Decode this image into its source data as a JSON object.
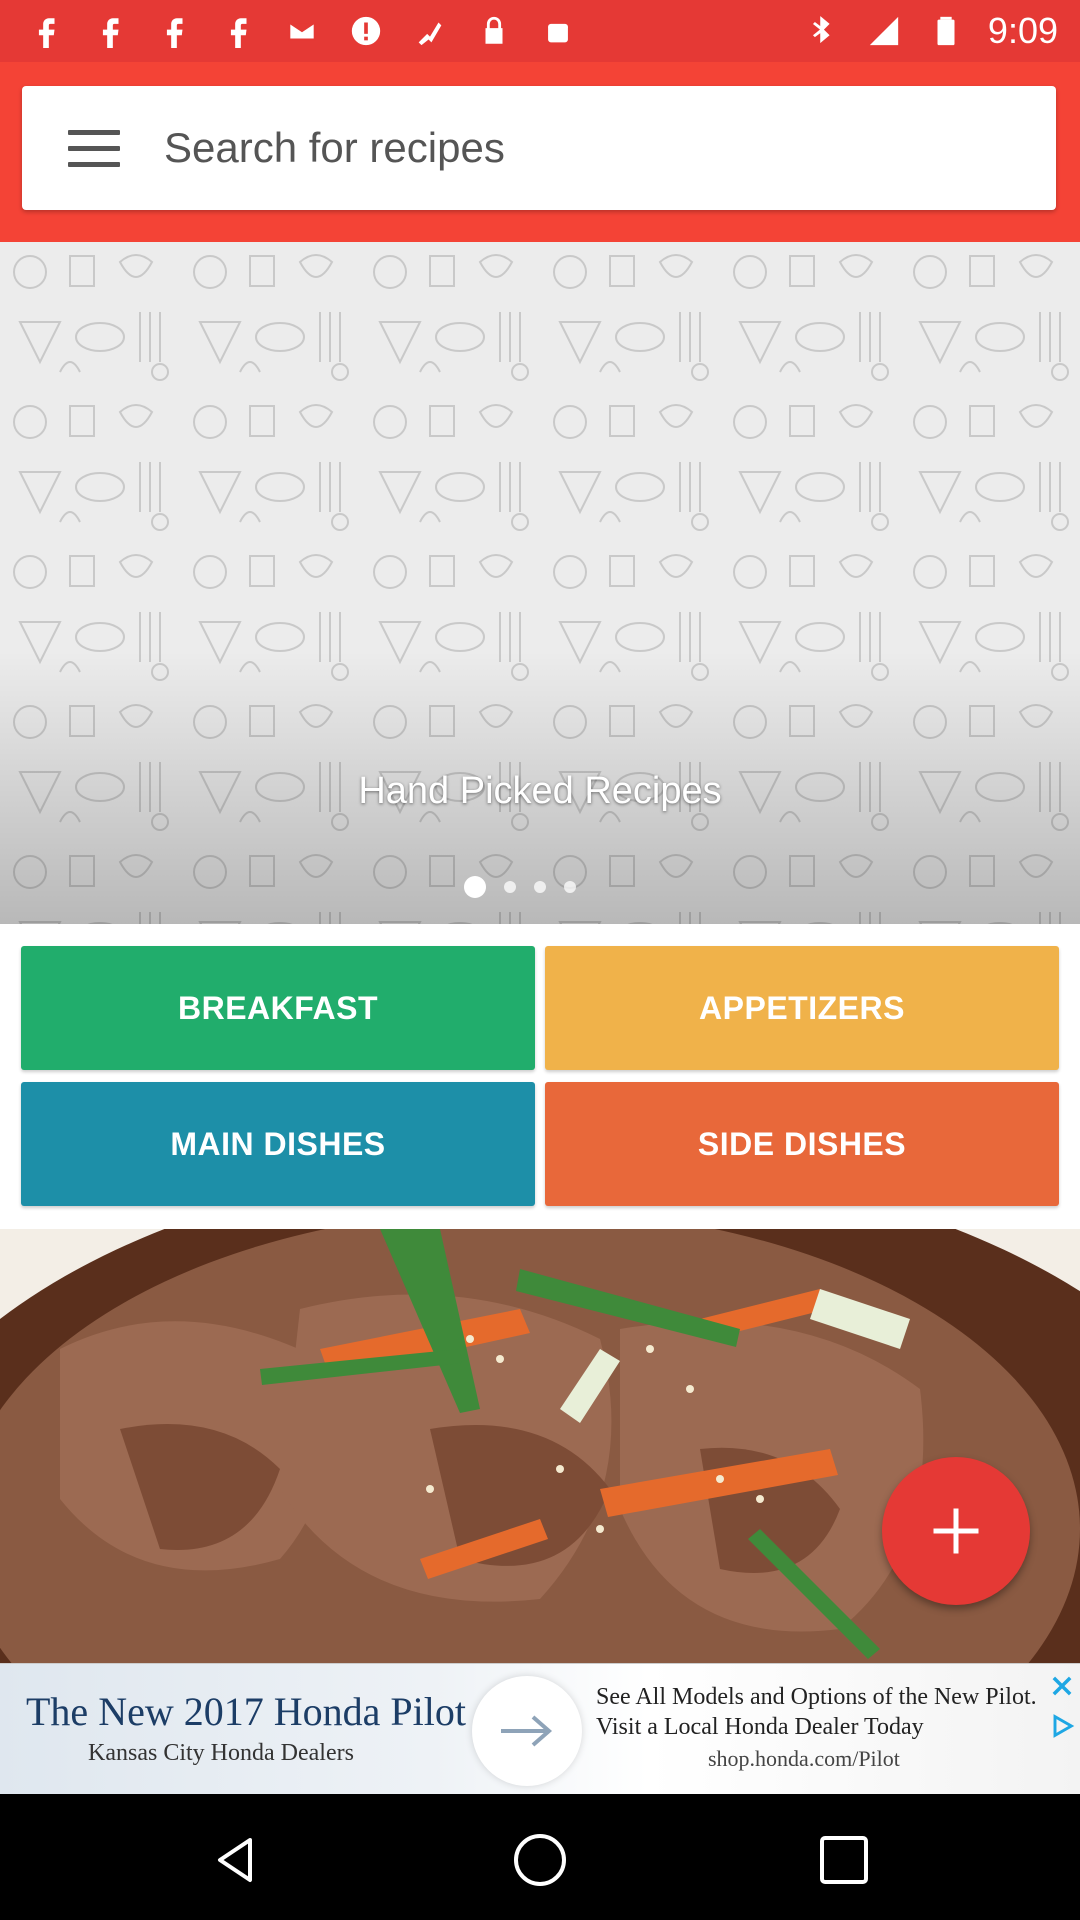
{
  "status_bar": {
    "time": "9:09",
    "left_icons": [
      "facebook-icon",
      "facebook-icon",
      "facebook-icon",
      "facebook-icon",
      "mail-icon",
      "alert-icon",
      "fake-gps-icon",
      "lock-icon",
      "android-icon"
    ],
    "right_icons": [
      "bluetooth-icon",
      "signal-icon",
      "battery-icon"
    ]
  },
  "header": {
    "search_placeholder": "Search for recipes"
  },
  "hero": {
    "title": "Hand Picked Recipes",
    "page_count": 4,
    "active_page": 1
  },
  "categories": [
    {
      "label": "BREAKFAST",
      "color": "#21ad6c"
    },
    {
      "label": "APPETIZERS",
      "color": "#f0b24a"
    },
    {
      "label": "MAIN DISHES",
      "color": "#1d8fa8"
    },
    {
      "label": "SIDE DISHES",
      "color": "#e8683a"
    }
  ],
  "fab": {
    "icon": "plus-icon",
    "color": "#e53935"
  },
  "ad": {
    "title": "The New 2017 Honda Pilot",
    "subtitle": "Kansas City Honda Dealers",
    "description": "See All Models and Options of the New Pilot. Visit a Local Honda Dealer Today",
    "link": "shop.honda.com/Pilot"
  },
  "nav": {
    "back": "back-icon",
    "home": "home-icon",
    "recents": "recents-icon"
  },
  "colors": {
    "primary": "#f44336",
    "status": "#e53935"
  }
}
